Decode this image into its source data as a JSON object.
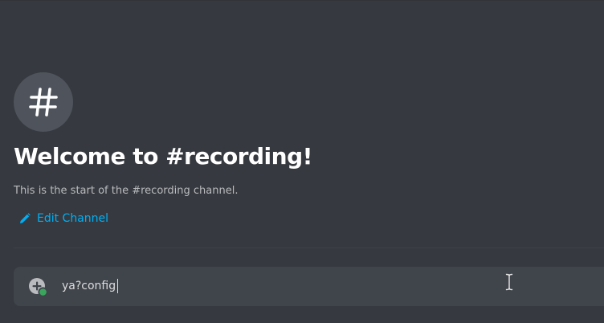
{
  "channel": {
    "icon": "hash-icon",
    "welcome_title": "Welcome to #recording!",
    "welcome_subtitle": "This is the start of the #recording channel.",
    "edit_label": "Edit Channel"
  },
  "composer": {
    "attach_icon": "add-circle-icon",
    "input_value": "ya?config"
  },
  "colors": {
    "background": "#36393f",
    "icon_circle": "#4f545c",
    "composer_bg": "#40444b",
    "link": "#00b0f4",
    "title": "#ffffff",
    "subtitle": "#b9bbbe",
    "status_green": "#3ba55d"
  }
}
